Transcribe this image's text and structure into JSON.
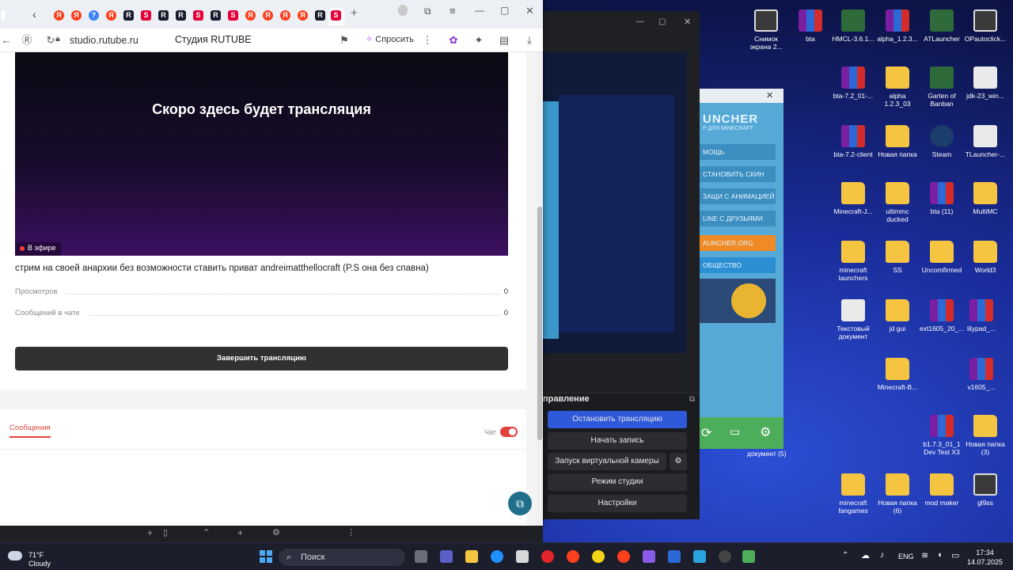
{
  "browser": {
    "url": "studio.rutube.ru",
    "page_title": "Студия RUTUBE",
    "ask_label": "Спросить"
  },
  "studio": {
    "video_message": "Скоро здесь будет трансляция",
    "live_badge": "В эфире",
    "stream_title": "стрим на своей анархии без возможности ставить приват andreimatthellocraft (P.S она без спавна)",
    "views_label": "Просмотров",
    "views_value": "0",
    "chat_messages_label": "Сообщений в чате",
    "chat_messages_value": "0",
    "end_button": "Завершить трансляцию",
    "chat_tab": "Сообщения",
    "chat_toggle_label": "Чат"
  },
  "obs": {
    "controls_title": "правление",
    "buttons": [
      "Остановить трансляцию",
      "Начать запись",
      "Запуск виртуальной камеры",
      "Режим студии",
      "Настройки"
    ]
  },
  "tlauncher": {
    "logo": "UNCHER",
    "subtitle": "Р ДЛЯ MINECRAFT",
    "menu": [
      "МОЩЬ",
      "СТАНОВИТЬ СКИН",
      "ЗАЩИ С АНИМАЦИЕЙ",
      "LINE С ДРУЗЬЯМИ",
      "AUNCHER.ORG",
      "ОБЩЕСТВО"
    ]
  },
  "desktop": {
    "icons": [
      {
        "label": "Снимок экрана 2...",
        "kind": "img"
      },
      {
        "label": "bta",
        "kind": "rar"
      },
      {
        "label": "HMCL-3.6.1...",
        "kind": "app"
      },
      {
        "label": "alpha_1.2.3...",
        "kind": "rar"
      },
      {
        "label": "ATLauncher",
        "kind": "app"
      },
      {
        "label": "OPautoclick...",
        "kind": "img"
      },
      {
        "label": "bta-7.2_01-...",
        "kind": "rar"
      },
      {
        "label": "alpha 1.2.3_03",
        "kind": "folder"
      },
      {
        "label": "Garten of Banban",
        "kind": "app"
      },
      {
        "label": "jdk-23_win...",
        "kind": "doc"
      },
      {
        "label": "bta-7.2-client",
        "kind": "rar"
      },
      {
        "label": "Новая папка",
        "kind": "folder"
      },
      {
        "label": "Steam",
        "kind": "steam"
      },
      {
        "label": "TLauncher-...",
        "kind": "doc"
      },
      {
        "label": "Minecraft-J...",
        "kind": "folder"
      },
      {
        "label": "ultimmc ducked",
        "kind": "folder"
      },
      {
        "label": "bta (11)",
        "kind": "rar"
      },
      {
        "label": "MultiMC",
        "kind": "folder"
      },
      {
        "label": "minecraft launchers",
        "kind": "folder"
      },
      {
        "label": "SS",
        "kind": "folder"
      },
      {
        "label": "Uncomfirmed",
        "kind": "folder"
      },
      {
        "label": "World3",
        "kind": "folder"
      },
      {
        "label": "Текстовый документ",
        "kind": "doc"
      },
      {
        "label": "jd gui",
        "kind": "folder"
      },
      {
        "label": "ext1605_20_...",
        "kind": "rar"
      },
      {
        "label": "lilypad_...",
        "kind": "rar"
      },
      {
        "label": "Minecraft-B...",
        "kind": "folder"
      },
      {
        "label": "v1605_...",
        "kind": "rar"
      },
      {
        "label": "b1.7.3_01_1 Dev Test X3",
        "kind": "rar"
      },
      {
        "label": "Новая папка (3)",
        "kind": "folder"
      },
      {
        "label": "minecraft fangames",
        "kind": "folder"
      },
      {
        "label": "Новая папка (6)",
        "kind": "folder"
      },
      {
        "label": "mod maker",
        "kind": "folder"
      },
      {
        "label": "gl9ss",
        "kind": "img"
      }
    ],
    "partial_label": "документ (5)"
  },
  "taskbar": {
    "temperature": "71°F",
    "weather": "Cloudy",
    "search_placeholder": "Поиск",
    "lang": "ENG",
    "time": "17:34",
    "date": "14.07.2025"
  }
}
